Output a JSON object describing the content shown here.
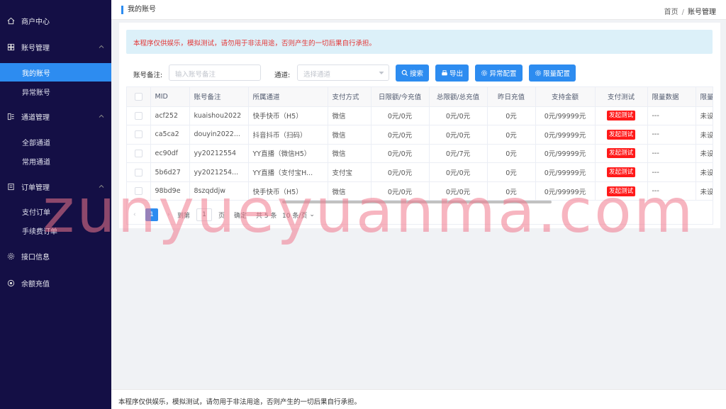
{
  "sidebar": {
    "groups": [
      {
        "label": "商户中心",
        "icon": "home-icon"
      },
      {
        "label": "账号管理",
        "icon": "grid-icon"
      },
      {
        "label": "通道管理",
        "icon": "channel-icon"
      },
      {
        "label": "订单管理",
        "icon": "document-icon"
      },
      {
        "label": "接口信息",
        "icon": "gear-icon"
      },
      {
        "label": "余额充值",
        "icon": "coin-icon"
      }
    ],
    "account_items": [
      "我的账号",
      "异常账号"
    ],
    "channel_items": [
      "全部通道",
      "常用通道"
    ],
    "order_items": [
      "支付订单",
      "手续费订单"
    ]
  },
  "header": {
    "title": "我的账号",
    "breadcrumb": [
      "首页",
      "/",
      "账号管理"
    ]
  },
  "notice": "本程序仅供娱乐，模拟测试，请勿用于非法用途，否则产生的一切后果自行承担。",
  "filters": {
    "remark_label": "账号备注:",
    "remark_placeholder": "输入账号备注",
    "channel_label": "通道:",
    "channel_placeholder": "选择通道"
  },
  "buttons": {
    "search": "搜索",
    "export": "导出",
    "abnormal_config": "异常配置",
    "limit_config": "限量配置"
  },
  "table": {
    "headers": [
      "MID",
      "账号备注",
      "所属通道",
      "支付方式",
      "日限额/今充值",
      "总限额/总充值",
      "昨日充值",
      "支持金额",
      "支付测试",
      "限量数据",
      "限量"
    ],
    "rows": [
      {
        "mid": "acf252",
        "remark": "kuaishou2022",
        "channel": "快手快币（H5）",
        "pay": "微信",
        "daily": "0元/0元",
        "total": "0元/0元",
        "yesterday": "0元",
        "amount": "0元/99999元",
        "test": "发起测试",
        "limit_data": "---",
        "limit": "未设"
      },
      {
        "mid": "ca5ca2",
        "remark": "douyin2022...",
        "channel": "抖音抖币（扫码）",
        "pay": "微信",
        "daily": "0元/0元",
        "total": "0元/0元",
        "yesterday": "0元",
        "amount": "0元/99999元",
        "test": "发起测试",
        "limit_data": "---",
        "limit": "未设"
      },
      {
        "mid": "ec90df",
        "remark": "yy20212554",
        "channel": "YY直播（微信H5）",
        "pay": "微信",
        "daily": "0元/0元",
        "total": "0元/7元",
        "yesterday": "0元",
        "amount": "0元/99999元",
        "test": "发起测试",
        "limit_data": "---",
        "limit": "未设"
      },
      {
        "mid": "5b6d27",
        "remark": "yy2021254...",
        "channel": "YY直播（支付宝H...",
        "pay": "支付宝",
        "daily": "0元/0元",
        "total": "0元/0元",
        "yesterday": "0元",
        "amount": "0元/99999元",
        "test": "发起测试",
        "limit_data": "---",
        "limit": "未设"
      },
      {
        "mid": "98bd9e",
        "remark": "8szqddjw",
        "channel": "快手快币（H5）",
        "pay": "微信",
        "daily": "0元/0元",
        "total": "0元/0元",
        "yesterday": "0元",
        "amount": "0元/99999元",
        "test": "发起测试",
        "limit_data": "---",
        "limit": "未设"
      }
    ]
  },
  "pager": {
    "page": "1",
    "goto_label": "到第",
    "goto_value": "1",
    "page_unit": "页",
    "confirm": "确定",
    "total": "共 5 条",
    "page_size": "10 条/页"
  },
  "watermark": "zunyueyuanma.com",
  "footer": "本程序仅供娱乐，模拟测试，请勿用于非法用途，否则产生的一切后果自行承担。",
  "colors": {
    "sidebar_bg": "#140f45",
    "accent": "#2d8cf0",
    "danger": "#ff1a1a",
    "notice_bg": "#dcf0f9"
  }
}
